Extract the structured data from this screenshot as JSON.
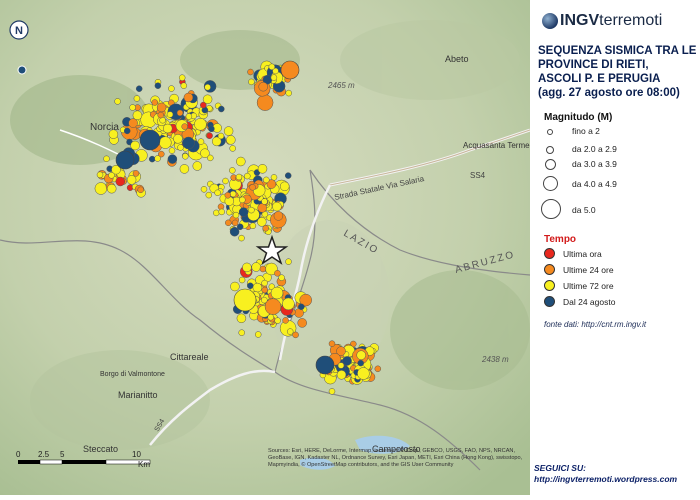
{
  "map": {
    "place_labels": [
      {
        "text": "Norcia"
      },
      {
        "text": "Abeto"
      },
      {
        "text": "Acquasanta Terme"
      },
      {
        "text": "Cittareale"
      },
      {
        "text": "Marianitto"
      },
      {
        "text": "Steccato"
      },
      {
        "text": "Campotosto"
      },
      {
        "text": "Borgo di Valmontone"
      },
      {
        "text": "LAZIO"
      },
      {
        "text": "ABRUZZO"
      },
      {
        "text": "Strada Statale Via Salaria"
      },
      {
        "text": "SS4"
      },
      {
        "text": "SS4"
      },
      {
        "text": "2465 m"
      },
      {
        "text": "2438 m"
      }
    ],
    "scale_bar": {
      "ticks": [
        "0",
        "2.5",
        "5",
        "10"
      ],
      "unit": "Km"
    },
    "north_symbol": "N",
    "attribution": "Sources: Esri, HERE, DeLorme, Intermap, increment P Corp., GEBCO, USGS, FAO, NPS, NRCAN, GeoBase, IGN, Kadaster NL, Ordnance Survey, Esri Japan, METI, Esri China (Hong Kong), swisstopo, Mapmyindia, © OpenStreetMap contributors, and the GIS User Community",
    "colors": {
      "last_hour": "#e8281e",
      "last_24h": "#f58a1f",
      "last_72h": "#f8f020",
      "since_24_aug": "#1f4e79"
    }
  },
  "legend": {
    "brand_bold": "INGV",
    "brand_rest": "terremoti",
    "title_lines": [
      "SEQUENZA SISMICA TRA LE",
      "PROVINCE DI RIETI,",
      "ASCOLI P. E PERUGIA",
      "(agg. 27 agosto ore 08:00)"
    ],
    "magnitude_heading": "Magnitudo (M)",
    "magnitude_items": [
      "fino a 2",
      "da 2.0 a 2.9",
      "da 3.0 a 3.9",
      "da 4.0 a 4.9",
      "da 5.0"
    ],
    "time_heading": "Tempo",
    "time_items": [
      {
        "label": "Ultima ora",
        "color": "#e8281e"
      },
      {
        "label": "Ultime 24 ore",
        "color": "#f58a1f"
      },
      {
        "label": "Ultime 72 ore",
        "color": "#f8f020"
      },
      {
        "label": "Dal 24 agosto",
        "color": "#1f4e79"
      }
    ],
    "source": "fonte dati: http://cnt.rm.ingv.it",
    "follow_label": "SEGUICI SU:",
    "follow_url": "http://ingvterremoti.wordpress.com"
  }
}
